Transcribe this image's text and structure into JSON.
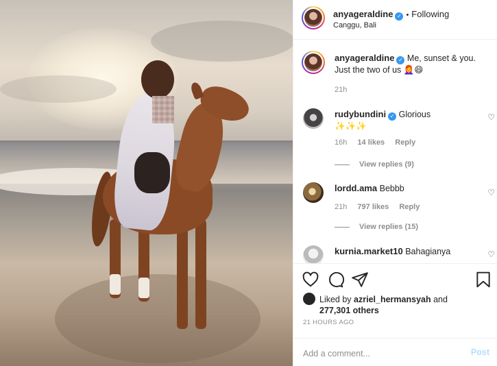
{
  "post": {
    "author": "anyageraldine",
    "location": "Canggu, Bali",
    "follow_status": "Following",
    "separator": "•"
  },
  "caption": {
    "username": "anyageraldine",
    "text": "Me, sunset & you. Just the two of us 👩‍🦰😄",
    "time": "21h"
  },
  "comments": [
    {
      "username": "rudybundini",
      "verified": true,
      "text": "Glorious",
      "extra_line": "✨✨✨",
      "time": "16h",
      "likes": "14 likes",
      "reply": "Reply",
      "view_replies": "View replies (9)"
    },
    {
      "username": "lordd.ama",
      "verified": false,
      "text": "Bebbb",
      "time": "21h",
      "likes": "797 likes",
      "reply": "Reply",
      "view_replies": "View replies (15)"
    },
    {
      "username": "kurnia.market10",
      "verified": false,
      "text": "Bahagianya"
    }
  ],
  "actions": {
    "like_icon": "heart-icon",
    "comment_icon": "comment-icon",
    "share_icon": "share-icon",
    "save_icon": "bookmark-icon"
  },
  "likes": {
    "prefix": "Liked by",
    "user": "azriel_hermansyah",
    "and": "and",
    "others": "277,301 others"
  },
  "timeago": "21 HOURS AGO",
  "comment_box": {
    "placeholder": "Add a comment...",
    "post_label": "Post"
  },
  "colors": {
    "verified": "#3897f0",
    "post_disabled": "#b2dffc",
    "muted": "#8e8e8e"
  }
}
